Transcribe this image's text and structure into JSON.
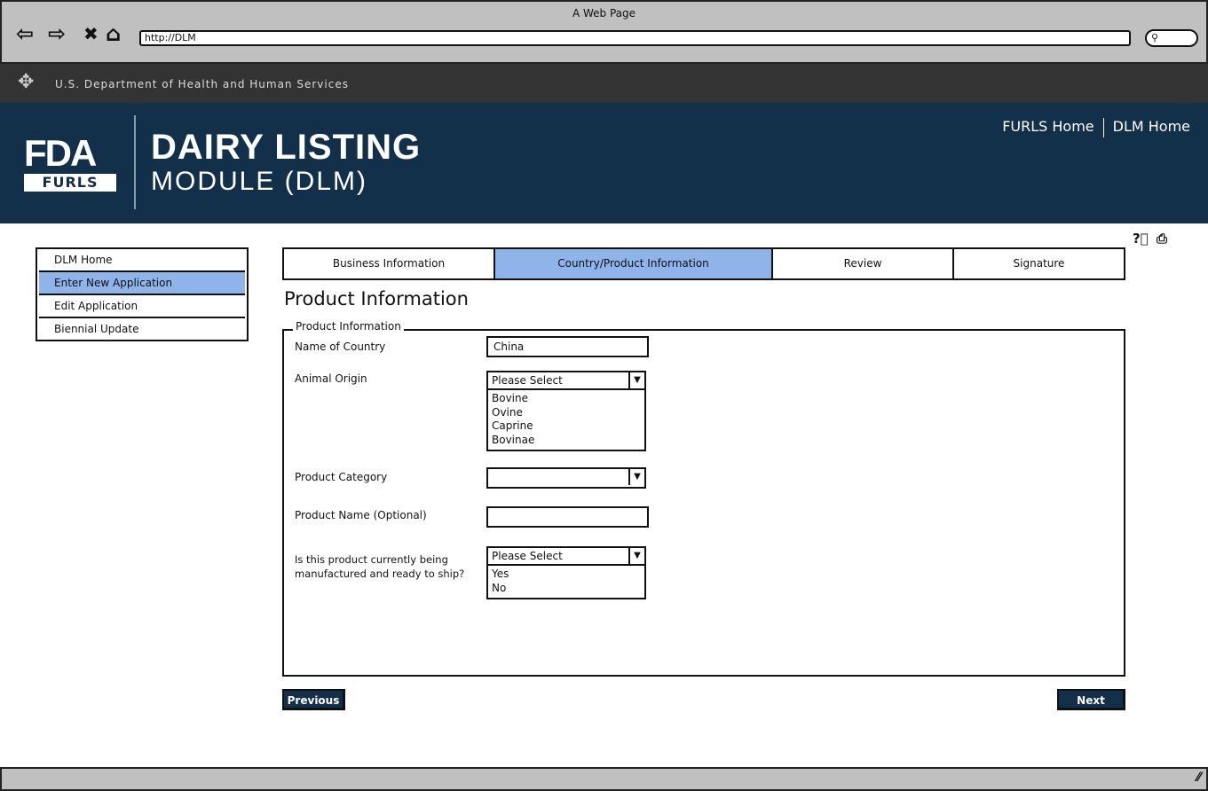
{
  "browser": {
    "title": "A Web Page",
    "url": "http://DLM",
    "search_icon": "magnifier-icon"
  },
  "header": {
    "agency": "U.S. Department of Health and Human Services",
    "logo_text": "FDA",
    "logo_sub": "FURLS",
    "title_line1": "DAIRY LISTING",
    "title_line2": "MODULE (DLM)",
    "links": [
      "FURLS Home",
      "DLM Home"
    ]
  },
  "sidebar": {
    "items": [
      {
        "label": "DLM Home"
      },
      {
        "label": "Enter New Application",
        "active": true
      },
      {
        "label": "Edit Application"
      },
      {
        "label": "Biennial Update"
      }
    ]
  },
  "tabs": [
    {
      "label": "Business Information"
    },
    {
      "label": "Country/Product Information",
      "active": true
    },
    {
      "label": "Review"
    },
    {
      "label": "Signature"
    }
  ],
  "page": {
    "heading": "Product Information",
    "fieldset_legend": "Product Information"
  },
  "form": {
    "country": {
      "label": "Name of Country",
      "value": "China"
    },
    "animal_origin": {
      "label": "Animal Origin",
      "selected": "Please Select",
      "options": [
        "Bovine",
        "Ovine",
        "Caprine",
        "Bovinae"
      ]
    },
    "product_category": {
      "label": "Product Category",
      "selected": ""
    },
    "product_name": {
      "label": "Product Name (Optional)",
      "value": ""
    },
    "ready": {
      "label_line1": "Is this product currently being",
      "label_line2": "manufactured and ready to ship?",
      "selected": "Please Select",
      "options": [
        "Yes",
        "No"
      ]
    }
  },
  "buttons": {
    "previous": "Previous",
    "next": "Next"
  },
  "colors": {
    "banner": "#12304a",
    "active": "#8fb4ea",
    "agency_bar": "#333333"
  }
}
